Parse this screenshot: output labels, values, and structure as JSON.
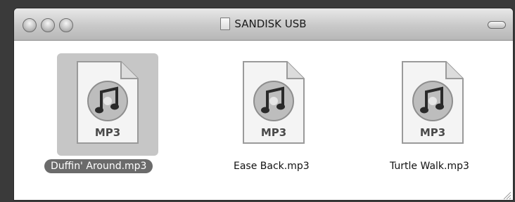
{
  "window": {
    "title": "SANDISK USB"
  },
  "files": [
    {
      "name": "Duffin' Around.mp3",
      "type_label": "MP3",
      "selected": true
    },
    {
      "name": "Ease Back.mp3",
      "type_label": "MP3",
      "selected": false
    },
    {
      "name": "Turtle Walk.mp3",
      "type_label": "MP3",
      "selected": false
    }
  ],
  "icons": {
    "close": "close-button-icon",
    "minimize": "minimize-button-icon",
    "zoom": "zoom-button-icon",
    "toolbar_toggle": "toolbar-toggle-icon",
    "disk": "usb-drive-icon",
    "file": "mp3-file-icon",
    "resize": "resize-grip-icon"
  }
}
